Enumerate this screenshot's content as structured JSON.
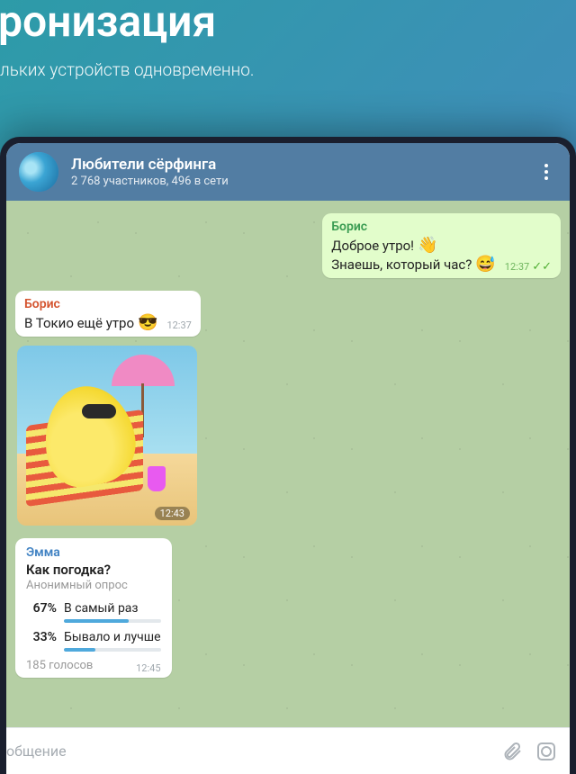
{
  "hero": {
    "title": "ронизация",
    "subtitle": "льких устройств одновременно."
  },
  "header": {
    "title": "Любители сёрфинга",
    "subtitle": "2 768 участников, 496 в сети"
  },
  "out_msg": {
    "sender": "Борис",
    "line1": "Доброе утро!",
    "emoji1": "👋",
    "line2": "Знаешь, который час?",
    "emoji2": "😅",
    "time": "12:37"
  },
  "in_msg": {
    "sender": "Борис",
    "text": "В Токио ещё утро",
    "emoji": "😎",
    "time": "12:37"
  },
  "sticker": {
    "time": "12:43"
  },
  "poll": {
    "sender": "Эмма",
    "question": "Как погодка?",
    "type": "Анонимный опрос",
    "options": [
      {
        "pct": "67%",
        "label": "В самый раз",
        "fill": 67
      },
      {
        "pct": "33%",
        "label": "Бывало и лучше",
        "fill": 33
      }
    ],
    "votes": "185 голосов",
    "time": "12:45"
  },
  "input": {
    "placeholder": "общение"
  }
}
